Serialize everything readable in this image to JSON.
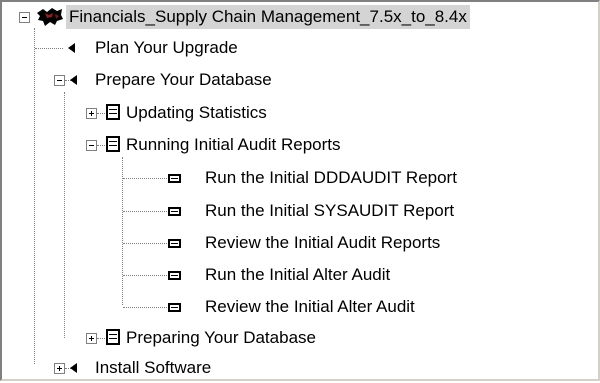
{
  "tree": {
    "root": {
      "label": "Financials_Supply Chain Management_7.5x_to_8.4x",
      "icon": "flock-logo-icon",
      "expanded": true
    },
    "items": [
      {
        "label": "Plan Your Upgrade",
        "icon": "triangle-marker-icon"
      },
      {
        "label": "Prepare Your Database",
        "icon": "triangle-marker-icon",
        "expanded": true
      },
      {
        "label": "Updating Statistics",
        "icon": "task-group-icon",
        "expanded": false
      },
      {
        "label": "Running Initial Audit Reports",
        "icon": "task-group-icon",
        "expanded": true
      },
      {
        "label": "Run the Initial DDDAUDIT Report",
        "icon": "task-icon"
      },
      {
        "label": "Run the Initial SYSAUDIT Report",
        "icon": "task-icon"
      },
      {
        "label": "Review the Initial Audit Reports",
        "icon": "task-icon"
      },
      {
        "label": "Run the Initial Alter Audit",
        "icon": "task-icon"
      },
      {
        "label": "Review the Initial Alter Audit",
        "icon": "task-icon"
      },
      {
        "label": "Preparing Your Database",
        "icon": "task-group-icon",
        "expanded": false
      },
      {
        "label": "Install Software",
        "icon": "triangle-marker-icon",
        "expanded": false
      }
    ]
  },
  "colors": {
    "selection": "#d4d4d4",
    "tree_lines": "#808080",
    "background": "#ffffff"
  }
}
